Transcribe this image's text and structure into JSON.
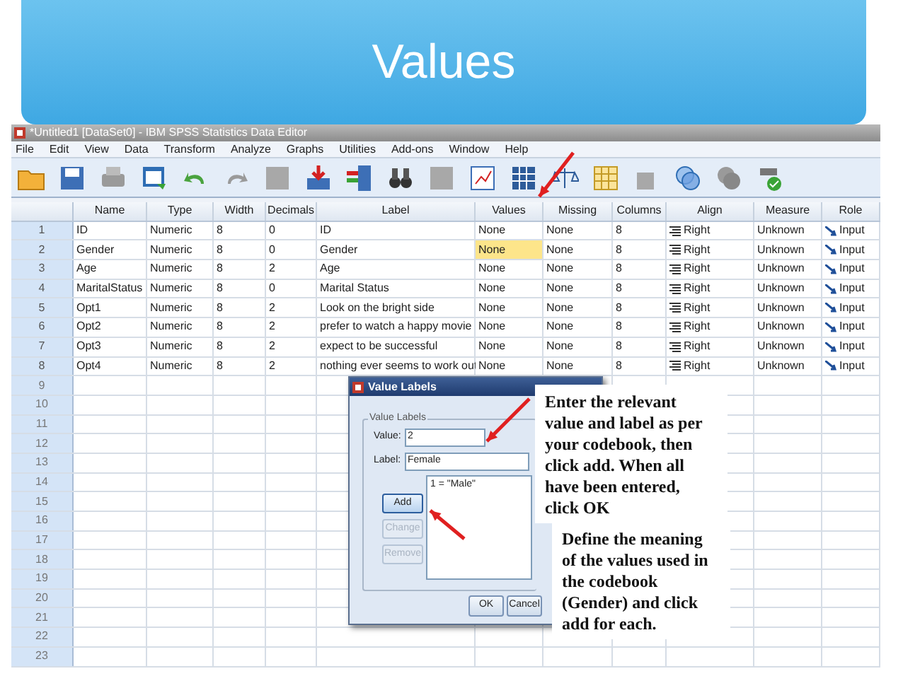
{
  "slide_title": "Values",
  "window": {
    "title": "*Untitled1 [DataSet0] - IBM SPSS Statistics Data Editor"
  },
  "menu": [
    "File",
    "Edit",
    "View",
    "Data",
    "Transform",
    "Analyze",
    "Graphs",
    "Utilities",
    "Add-ons",
    "Window",
    "Help"
  ],
  "columns": [
    {
      "label": "Name",
      "kind": "text"
    },
    {
      "label": "Type",
      "kind": "text"
    },
    {
      "label": "Width",
      "kind": "text"
    },
    {
      "label": "Decimals",
      "kind": "text"
    },
    {
      "label": "Label",
      "kind": "text"
    },
    {
      "label": "Values",
      "kind": "text"
    },
    {
      "label": "Missing",
      "kind": "text"
    },
    {
      "label": "Columns",
      "kind": "text"
    },
    {
      "label": "Align",
      "kind": "align"
    },
    {
      "label": "Measure",
      "kind": "text"
    },
    {
      "label": "Role",
      "kind": "role"
    }
  ],
  "rows": [
    {
      "number": "1",
      "cells": [
        {
          "text": "ID",
          "selected": false
        },
        {
          "text": "Numeric",
          "selected": false
        },
        {
          "text": "8",
          "selected": false
        },
        {
          "text": "0",
          "selected": false
        },
        {
          "text": "ID",
          "selected": false
        },
        {
          "text": "None",
          "selected": false
        },
        {
          "text": "None",
          "selected": false
        },
        {
          "text": "8",
          "selected": false
        },
        {
          "text": "Right",
          "selected": false
        },
        {
          "text": "Unknown",
          "selected": false
        },
        {
          "text": "Input",
          "selected": false
        }
      ]
    },
    {
      "number": "2",
      "cells": [
        {
          "text": "Gender",
          "selected": false
        },
        {
          "text": "Numeric",
          "selected": false
        },
        {
          "text": "8",
          "selected": false
        },
        {
          "text": "0",
          "selected": false
        },
        {
          "text": "Gender",
          "selected": false
        },
        {
          "text": "None",
          "selected": true
        },
        {
          "text": "None",
          "selected": false
        },
        {
          "text": "8",
          "selected": false
        },
        {
          "text": "Right",
          "selected": false
        },
        {
          "text": "Unknown",
          "selected": false
        },
        {
          "text": "Input",
          "selected": false
        }
      ]
    },
    {
      "number": "3",
      "cells": [
        {
          "text": "Age",
          "selected": false
        },
        {
          "text": "Numeric",
          "selected": false
        },
        {
          "text": "8",
          "selected": false
        },
        {
          "text": "2",
          "selected": false
        },
        {
          "text": "Age",
          "selected": false
        },
        {
          "text": "None",
          "selected": false
        },
        {
          "text": "None",
          "selected": false
        },
        {
          "text": "8",
          "selected": false
        },
        {
          "text": "Right",
          "selected": false
        },
        {
          "text": "Unknown",
          "selected": false
        },
        {
          "text": "Input",
          "selected": false
        }
      ]
    },
    {
      "number": "4",
      "cells": [
        {
          "text": "MaritalStatus",
          "selected": false
        },
        {
          "text": "Numeric",
          "selected": false
        },
        {
          "text": "8",
          "selected": false
        },
        {
          "text": "0",
          "selected": false
        },
        {
          "text": "Marital Status",
          "selected": false
        },
        {
          "text": "None",
          "selected": false
        },
        {
          "text": "None",
          "selected": false
        },
        {
          "text": "8",
          "selected": false
        },
        {
          "text": "Right",
          "selected": false
        },
        {
          "text": "Unknown",
          "selected": false
        },
        {
          "text": "Input",
          "selected": false
        }
      ]
    },
    {
      "number": "5",
      "cells": [
        {
          "text": "Opt1",
          "selected": false
        },
        {
          "text": "Numeric",
          "selected": false
        },
        {
          "text": "8",
          "selected": false
        },
        {
          "text": "2",
          "selected": false
        },
        {
          "text": "Look on the bright side",
          "selected": false
        },
        {
          "text": "None",
          "selected": false
        },
        {
          "text": "None",
          "selected": false
        },
        {
          "text": "8",
          "selected": false
        },
        {
          "text": "Right",
          "selected": false
        },
        {
          "text": "Unknown",
          "selected": false
        },
        {
          "text": "Input",
          "selected": false
        }
      ]
    },
    {
      "number": "6",
      "cells": [
        {
          "text": "Opt2",
          "selected": false
        },
        {
          "text": "Numeric",
          "selected": false
        },
        {
          "text": "8",
          "selected": false
        },
        {
          "text": "2",
          "selected": false
        },
        {
          "text": "prefer to watch a happy movie",
          "selected": false
        },
        {
          "text": "None",
          "selected": false
        },
        {
          "text": "None",
          "selected": false
        },
        {
          "text": "8",
          "selected": false
        },
        {
          "text": "Right",
          "selected": false
        },
        {
          "text": "Unknown",
          "selected": false
        },
        {
          "text": "Input",
          "selected": false
        }
      ]
    },
    {
      "number": "7",
      "cells": [
        {
          "text": "Opt3",
          "selected": false
        },
        {
          "text": "Numeric",
          "selected": false
        },
        {
          "text": "8",
          "selected": false
        },
        {
          "text": "2",
          "selected": false
        },
        {
          "text": "expect to be successful",
          "selected": false
        },
        {
          "text": "None",
          "selected": false
        },
        {
          "text": "None",
          "selected": false
        },
        {
          "text": "8",
          "selected": false
        },
        {
          "text": "Right",
          "selected": false
        },
        {
          "text": "Unknown",
          "selected": false
        },
        {
          "text": "Input",
          "selected": false
        }
      ]
    },
    {
      "number": "8",
      "cells": [
        {
          "text": "Opt4",
          "selected": false
        },
        {
          "text": "Numeric",
          "selected": false
        },
        {
          "text": "8",
          "selected": false
        },
        {
          "text": "2",
          "selected": false
        },
        {
          "text": "nothing ever seems to work out",
          "selected": false
        },
        {
          "text": "None",
          "selected": false
        },
        {
          "text": "None",
          "selected": false
        },
        {
          "text": "8",
          "selected": false
        },
        {
          "text": "Right",
          "selected": false
        },
        {
          "text": "Unknown",
          "selected": false
        },
        {
          "text": "Input",
          "selected": false
        }
      ]
    }
  ],
  "empty_rows": [
    "9",
    "10",
    "11",
    "12",
    "13",
    "14",
    "15",
    "16",
    "17",
    "18",
    "19",
    "20",
    "21",
    "22",
    "23"
  ],
  "dialog": {
    "title": "Value Labels",
    "group_label": "Value Labels",
    "fields": [
      {
        "label": "Value:",
        "value": "2"
      },
      {
        "label": "Label:",
        "value": "Female"
      }
    ],
    "list_items": [
      "1 = \"Male\""
    ],
    "side_buttons": [
      {
        "label": "Add",
        "disabled": false
      },
      {
        "label": "Change",
        "disabled": true
      },
      {
        "label": "Remove",
        "disabled": true
      }
    ],
    "buttons": [
      "OK",
      "Cancel"
    ]
  },
  "callouts": [
    "Enter the relevant value and label as per your codebook, then click add. When all have been entered, click OK",
    "Define the meaning of the values used in the codebook (Gender) and click add for each."
  ]
}
